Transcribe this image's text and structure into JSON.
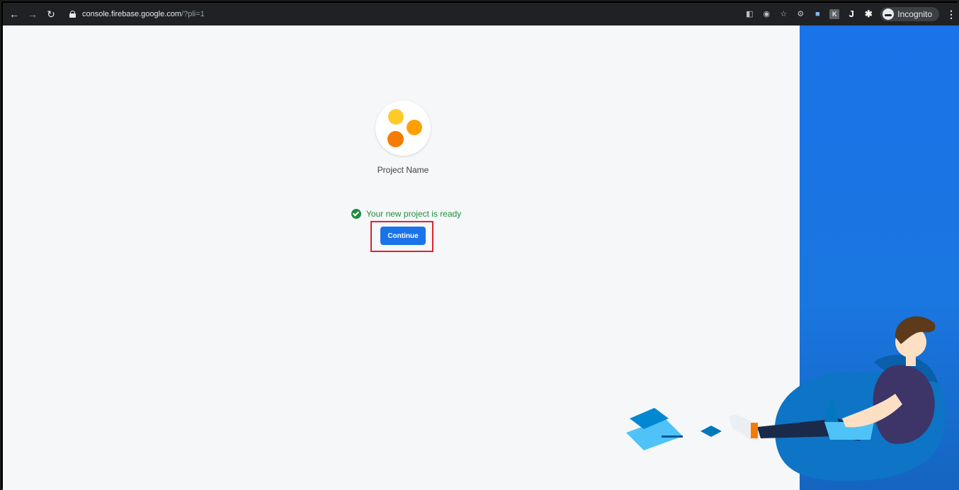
{
  "browser": {
    "url_host": "console.firebase.google.com",
    "url_path": "/?pli=1",
    "incognito_label": "Incognito",
    "ext_k_label": "K",
    "ext_j_label": "J"
  },
  "main": {
    "project_name": "Project Name",
    "status_text": "Your new project is ready",
    "continue_label": "Continue"
  },
  "colors": {
    "primary": "#1a73e8",
    "success": "#1e8e3e",
    "highlight": "#e0232e",
    "dot_yellow": "#ffca28",
    "dot_orange": "#ffa000",
    "dot_deep_orange": "#f57c00"
  }
}
